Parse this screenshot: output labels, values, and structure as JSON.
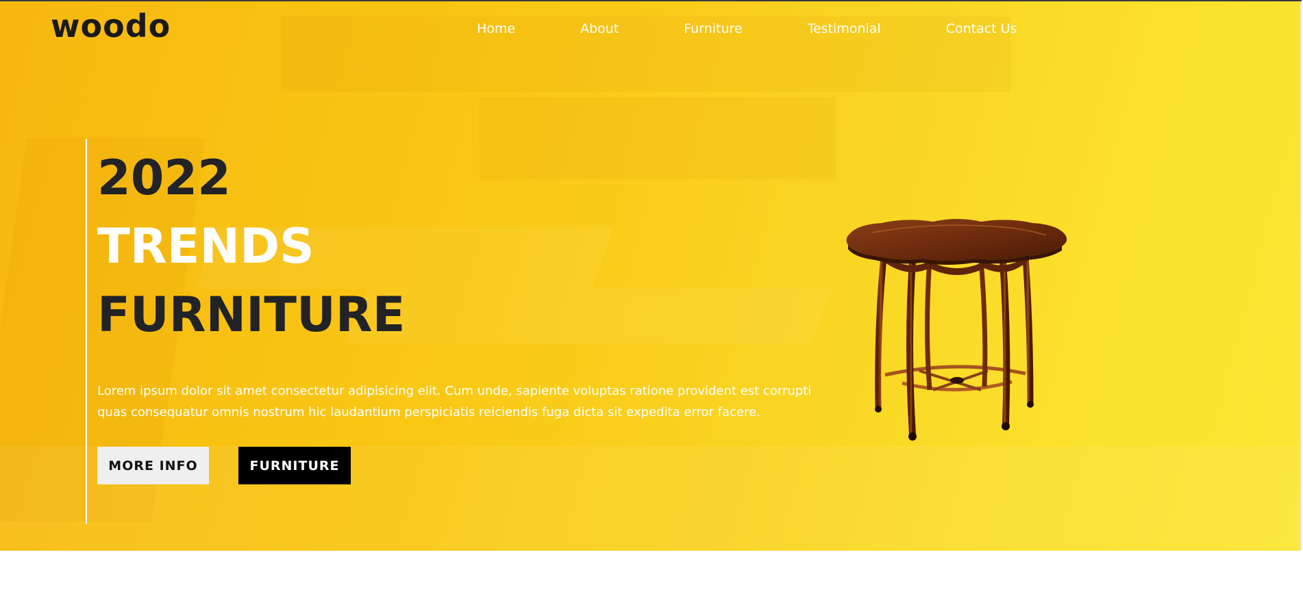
{
  "header": {
    "logo": "woodo",
    "nav": [
      {
        "label": "Home"
      },
      {
        "label": "About"
      },
      {
        "label": "Furniture"
      },
      {
        "label": "Testimonial"
      },
      {
        "label": "Contact Us"
      }
    ]
  },
  "hero": {
    "headline_line1": "2022",
    "headline_line2": "TRENDS",
    "headline_line3": "FURNITURE",
    "description": "Lorem ipsum dolor sit amet consectetur adipisicing elit. Cum unde, sapiente voluptas ratione provident est corrupti quas consequatur omnis nostrum hic laudantium perspiciatis reiciendis fuga dicta sit expedita error facere.",
    "buttons": {
      "more_info": "MORE INFO",
      "furniture": "FURNITURE"
    },
    "image": "wooden-table"
  },
  "colors": {
    "hero_gradient_start": "#f7b80f",
    "hero_gradient_end": "#fbe735",
    "headline_dark": "#222326",
    "headline_light": "#ffffff",
    "button_light_bg": "#efefef",
    "button_dark_bg": "#000000"
  }
}
